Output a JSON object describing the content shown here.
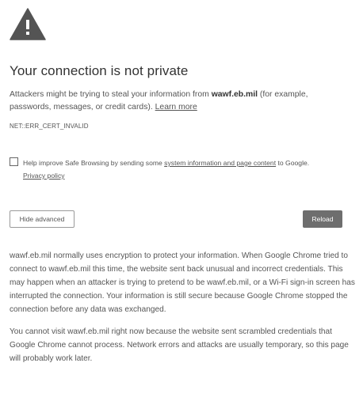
{
  "page": {
    "title": "Your connection is not private",
    "intro_prefix": "Attackers might be trying to steal your information from ",
    "domain": "wawf.eb.mil",
    "intro_suffix": " (for example, passwords, messages, or credit cards). ",
    "learn_more": "Learn more",
    "error_code": "NET::ERR_CERT_INVALID"
  },
  "safe_browsing": {
    "checked": false,
    "text_prefix": "Help improve Safe Browsing by sending some ",
    "link_text": "system information and page content",
    "text_suffix": " to Google.",
    "privacy_link": "Privacy policy"
  },
  "buttons": {
    "hide_advanced": "Hide advanced",
    "reload": "Reload"
  },
  "details": {
    "paragraph1": "wawf.eb.mil normally uses encryption to protect your information. When Google Chrome tried to connect to wawf.eb.mil this time, the website sent back unusual and incorrect credentials. This may happen when an attacker is trying to pretend to be wawf.eb.mil, or a Wi-Fi sign-in screen has interrupted the connection. Your information is still secure because Google Chrome stopped the connection before any data was exchanged.",
    "paragraph2": "You cannot visit wawf.eb.mil right now because the website sent scrambled credentials that Google Chrome cannot process. Network errors and attacks are usually temporary, so this page will probably work later."
  },
  "icons": {
    "warning": "warning-triangle-icon"
  },
  "colors": {
    "icon_fill": "#545454",
    "reload_bg": "#6e6e6e",
    "text": "#555555"
  }
}
